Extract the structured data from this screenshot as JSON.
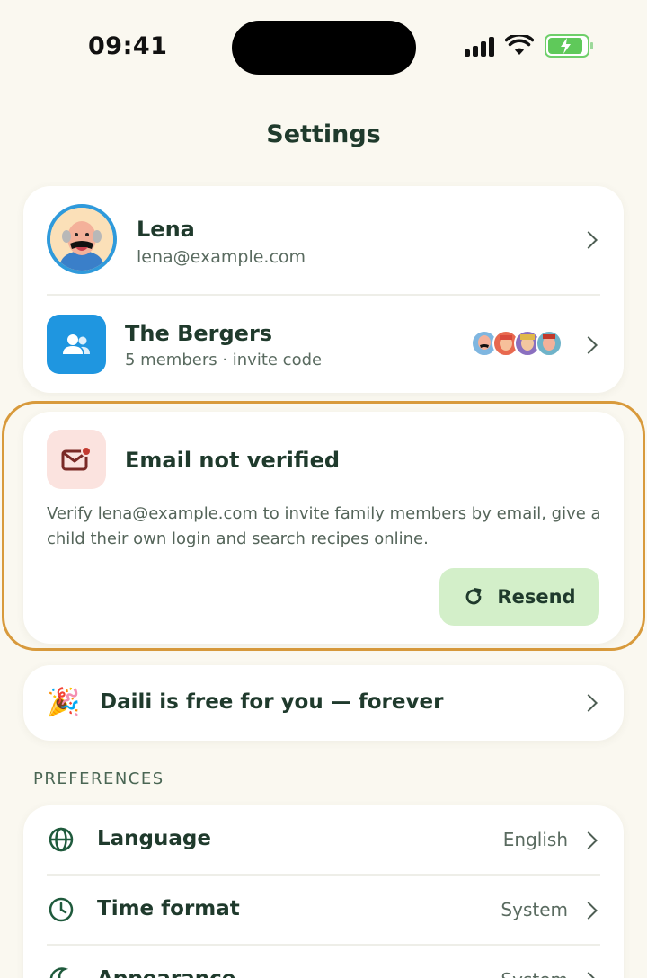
{
  "status": {
    "time": "09:41"
  },
  "header": {
    "title": "Settings"
  },
  "profile": {
    "name": "Lena",
    "email": "lena@example.com"
  },
  "family": {
    "name": "The Bergers",
    "subtitle": "5 members · invite code"
  },
  "verify": {
    "title": "Email not verified",
    "text": "Verify lena@example.com to invite family members by email, give a child their own login and search recipes online.",
    "button": "Resend"
  },
  "promo": {
    "text": "Daili is free for you — forever",
    "emoji": "🎉"
  },
  "preferences": {
    "section_title": "PREFERENCES",
    "items": [
      {
        "label": "Language",
        "value": "English",
        "icon": "globe-icon"
      },
      {
        "label": "Time format",
        "value": "System",
        "icon": "clock-icon"
      },
      {
        "label": "Appearance",
        "value": "System",
        "icon": "moon-icon"
      }
    ]
  },
  "colors": {
    "background": "#faf8f0",
    "text": "#1f3a2c",
    "accent_blue": "#1f96e0",
    "warning_border": "#d89a3c",
    "button_green": "#d3efc9",
    "mail_bg": "#fbe3df"
  }
}
